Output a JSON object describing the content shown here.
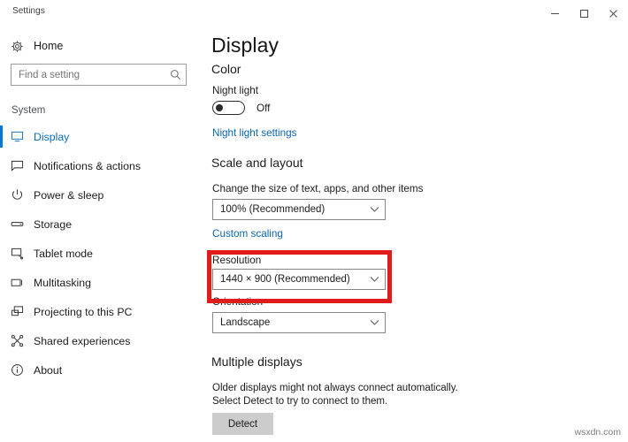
{
  "window": {
    "title": "Settings",
    "controls": [
      {
        "name": "minimize",
        "glyph": "minimize-icon"
      },
      {
        "name": "maximize",
        "glyph": "maximize-icon"
      },
      {
        "name": "close",
        "glyph": "close-icon"
      }
    ]
  },
  "sidebar": {
    "home_label": "Home",
    "home_icon": "gear-icon",
    "search": {
      "placeholder": "Find a setting",
      "value": "",
      "icon": "search-icon"
    },
    "group_title": "System",
    "items": [
      {
        "label": "Display",
        "icon": "monitor-icon",
        "selected": true
      },
      {
        "label": "Notifications & actions",
        "icon": "notification-icon",
        "selected": false
      },
      {
        "label": "Power & sleep",
        "icon": "power-icon",
        "selected": false
      },
      {
        "label": "Storage",
        "icon": "storage-icon",
        "selected": false
      },
      {
        "label": "Tablet mode",
        "icon": "tablet-icon",
        "selected": false
      },
      {
        "label": "Multitasking",
        "icon": "multitask-icon",
        "selected": false
      },
      {
        "label": "Projecting to this PC",
        "icon": "project-icon",
        "selected": false
      },
      {
        "label": "Shared experiences",
        "icon": "share-icon",
        "selected": false
      },
      {
        "label": "About",
        "icon": "info-icon",
        "selected": false
      }
    ]
  },
  "main": {
    "page_title": "Display",
    "color_section": {
      "heading": "Color",
      "night_light_label": "Night light",
      "night_light_state": "Off",
      "night_light_on": false,
      "settings_link": "Night light settings"
    },
    "scale_section": {
      "heading": "Scale and layout",
      "scale_label": "Change the size of text, apps, and other items",
      "scale_value": "100% (Recommended)",
      "custom_link": "Custom scaling",
      "resolution_label": "Resolution",
      "resolution_value": "1440 × 900 (Recommended)",
      "orientation_label": "Orientation",
      "orientation_value": "Landscape"
    },
    "multiple_displays": {
      "heading": "Multiple displays",
      "description": "Older displays might not always connect automatically. Select Detect to try to connect to them.",
      "detect_button": "Detect"
    },
    "highlight_color": "#e01b1b"
  },
  "watermark": "wsxdn.com"
}
